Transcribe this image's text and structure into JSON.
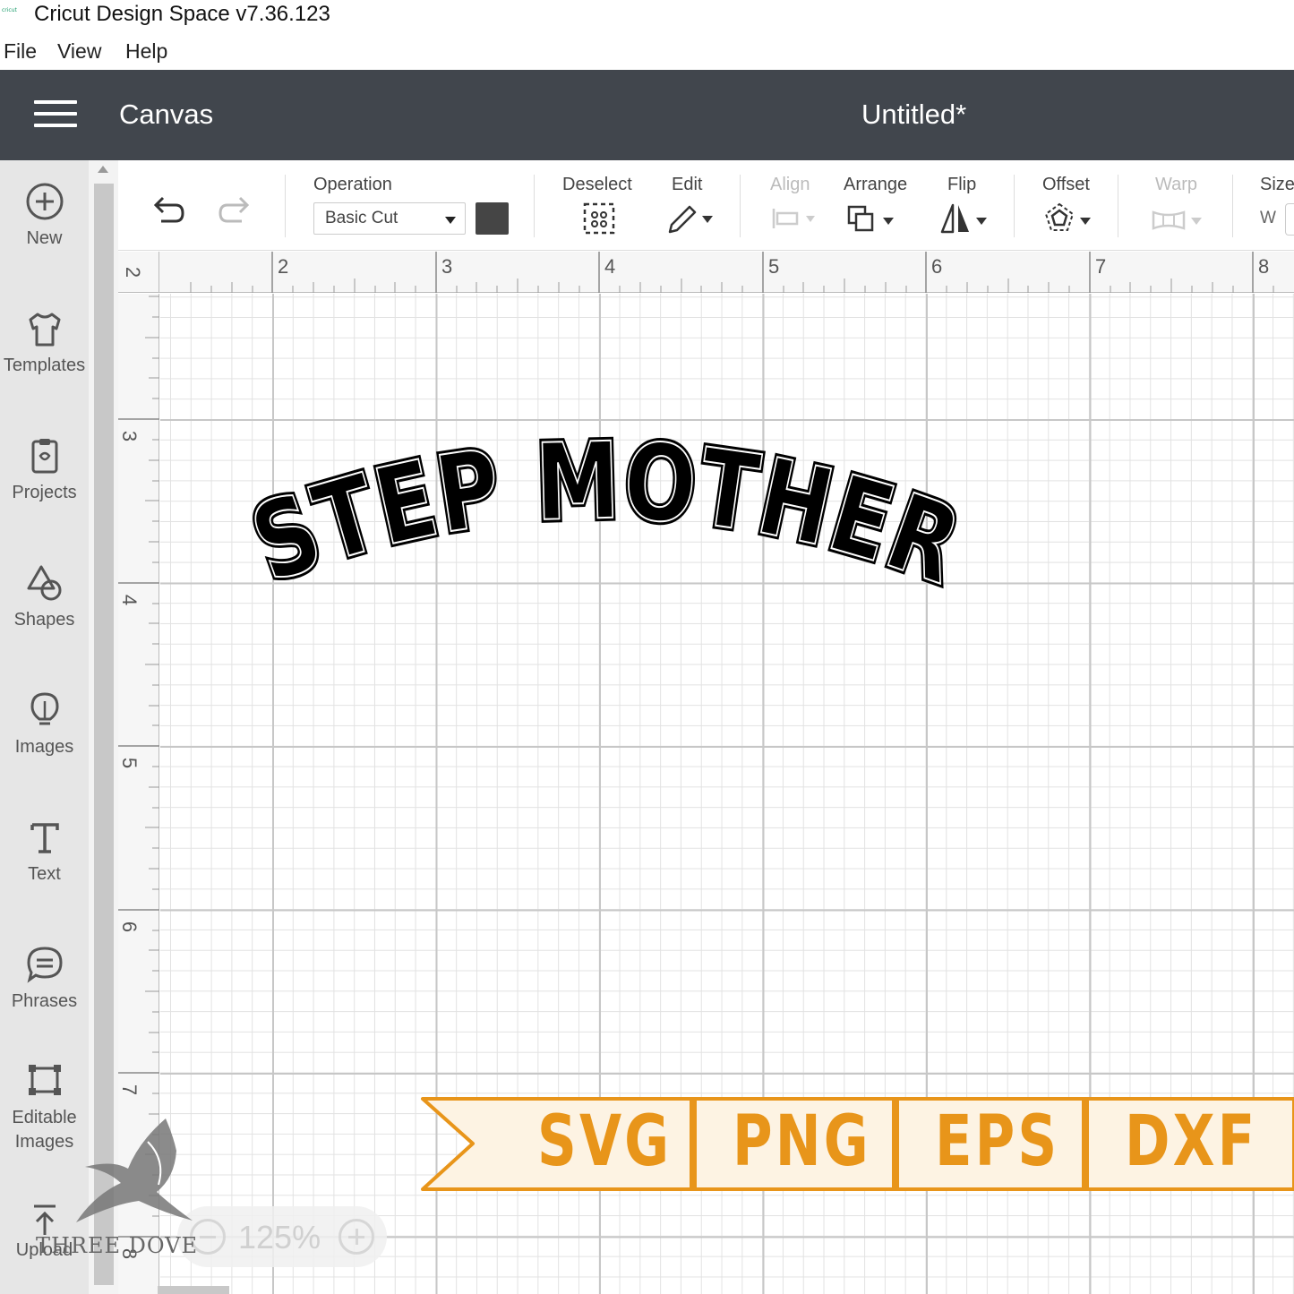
{
  "window": {
    "title": "Cricut Design Space  v7.36.123",
    "icon_text": "cricut"
  },
  "menu": [
    {
      "label": "File"
    },
    {
      "label": "View"
    },
    {
      "label": "Help"
    }
  ],
  "header": {
    "section": "Canvas",
    "document": "Untitled*"
  },
  "sidebar": {
    "items": [
      {
        "label": "New",
        "icon": "plus-circle-icon"
      },
      {
        "label": "Templates",
        "icon": "shirt-icon"
      },
      {
        "label": "Projects",
        "icon": "clipboard-icon"
      },
      {
        "label": "Shapes",
        "icon": "shapes-icon"
      },
      {
        "label": "Images",
        "icon": "lightbulb-icon"
      },
      {
        "label": "Text",
        "icon": "text-icon"
      },
      {
        "label": "Phrases",
        "icon": "speech-bubble-icon"
      },
      {
        "label": "Editable",
        "label2": "Images",
        "icon": "editable-image-icon"
      },
      {
        "label": "Upload",
        "icon": "upload-icon"
      }
    ]
  },
  "toolbar": {
    "operation_label": "Operation",
    "operation_value": "Basic Cut",
    "operation_color": "#454545",
    "deselect": "Deselect",
    "edit": "Edit",
    "align": "Align",
    "arrange": "Arrange",
    "flip": "Flip",
    "offset": "Offset",
    "warp": "Warp",
    "size": "Size",
    "size_w": "W"
  },
  "rulers": {
    "top": [
      "2",
      "2",
      "3",
      "4",
      "5",
      "6",
      "7",
      "8"
    ],
    "left": [
      "3",
      "4",
      "5",
      "6",
      "7",
      "8"
    ]
  },
  "canvas": {
    "text_object": "STEP MOTHER",
    "zoom": "125%"
  },
  "watermark": {
    "brand": "THREE DOVE"
  },
  "banner": {
    "formats": [
      "SVG",
      "PNG",
      "EPS",
      "DXF"
    ],
    "accent": "#e8951a",
    "background": "#fdf3e3"
  }
}
